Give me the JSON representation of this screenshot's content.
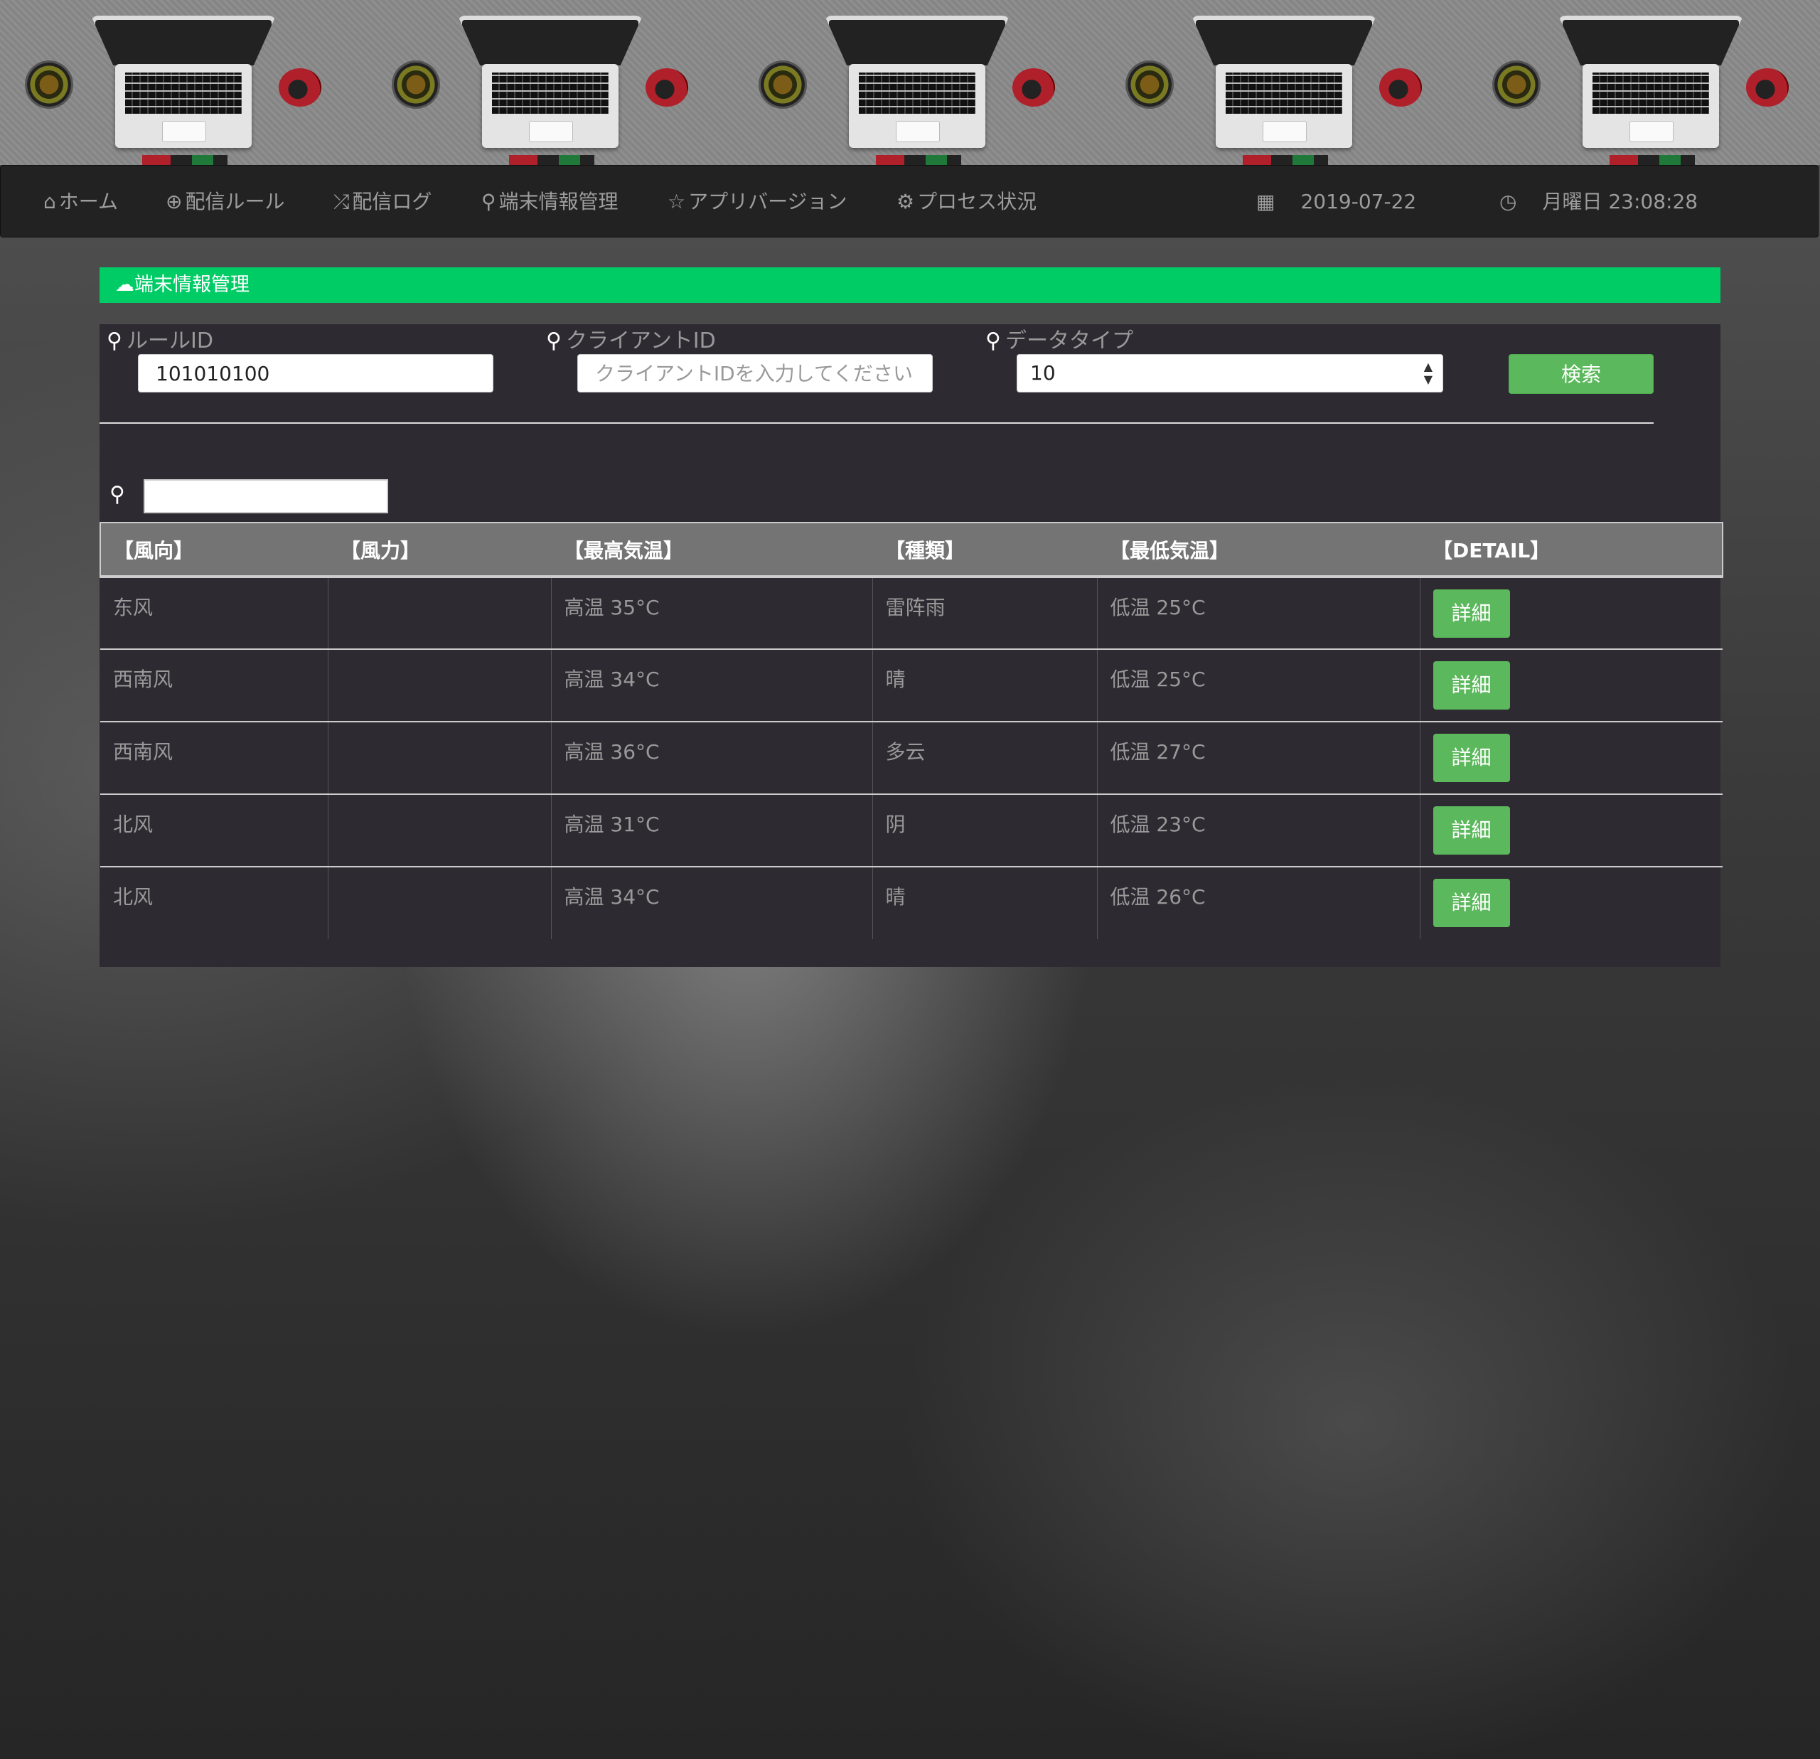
{
  "nav": {
    "items": [
      {
        "icon": "home-icon",
        "glyph": "⌂",
        "label": "ホーム"
      },
      {
        "icon": "zoom-in-icon",
        "glyph": "⊕",
        "label": "配信ルール"
      },
      {
        "icon": "random-icon",
        "glyph": "⤮",
        "label": "配信ログ"
      },
      {
        "icon": "search-icon",
        "glyph": "⚲",
        "label": "端末情報管理"
      },
      {
        "icon": "star-icon",
        "glyph": "☆",
        "label": "アプリバージョン"
      },
      {
        "icon": "gear-icon",
        "glyph": "⚙",
        "label": "プロセス状況"
      }
    ],
    "date": "2019-07-22",
    "time": "月曜日 23:08:28"
  },
  "panel": {
    "title": "端末情報管理"
  },
  "filters": {
    "rule_id_label": "ルールID",
    "rule_id_value": "101010100",
    "client_id_label": "クライアントID",
    "client_id_placeholder": "クライアントIDを入力してください",
    "data_type_label": "データタイプ",
    "data_type_value": "10",
    "search_button": "検索"
  },
  "table": {
    "headers": [
      "【風向】",
      "【風力】",
      "【最高気温】",
      "【種類】",
      "【最低気温】",
      "【DETAIL】"
    ],
    "rows": [
      {
        "wind_dir": "东风",
        "wind_power": "",
        "high": "高温 35°C",
        "type": "雷阵雨",
        "low": "低温 25°C",
        "detail": "詳細"
      },
      {
        "wind_dir": "西南风",
        "wind_power": "",
        "high": "高温 34°C",
        "type": "晴",
        "low": "低温 25°C",
        "detail": "詳細"
      },
      {
        "wind_dir": "西南风",
        "wind_power": "",
        "high": "高温 36°C",
        "type": "多云",
        "low": "低温 27°C",
        "detail": "詳細"
      },
      {
        "wind_dir": "北风",
        "wind_power": "",
        "high": "高温 31°C",
        "type": "阴",
        "low": "低温 23°C",
        "detail": "詳細"
      },
      {
        "wind_dir": "北风",
        "wind_power": "",
        "high": "高温 34°C",
        "type": "晴",
        "low": "低温 26°C",
        "detail": "詳細"
      }
    ]
  },
  "colors": {
    "panel_header": "#00cc66",
    "button_green": "#5cb85c",
    "navbar_bg": "#222222"
  }
}
